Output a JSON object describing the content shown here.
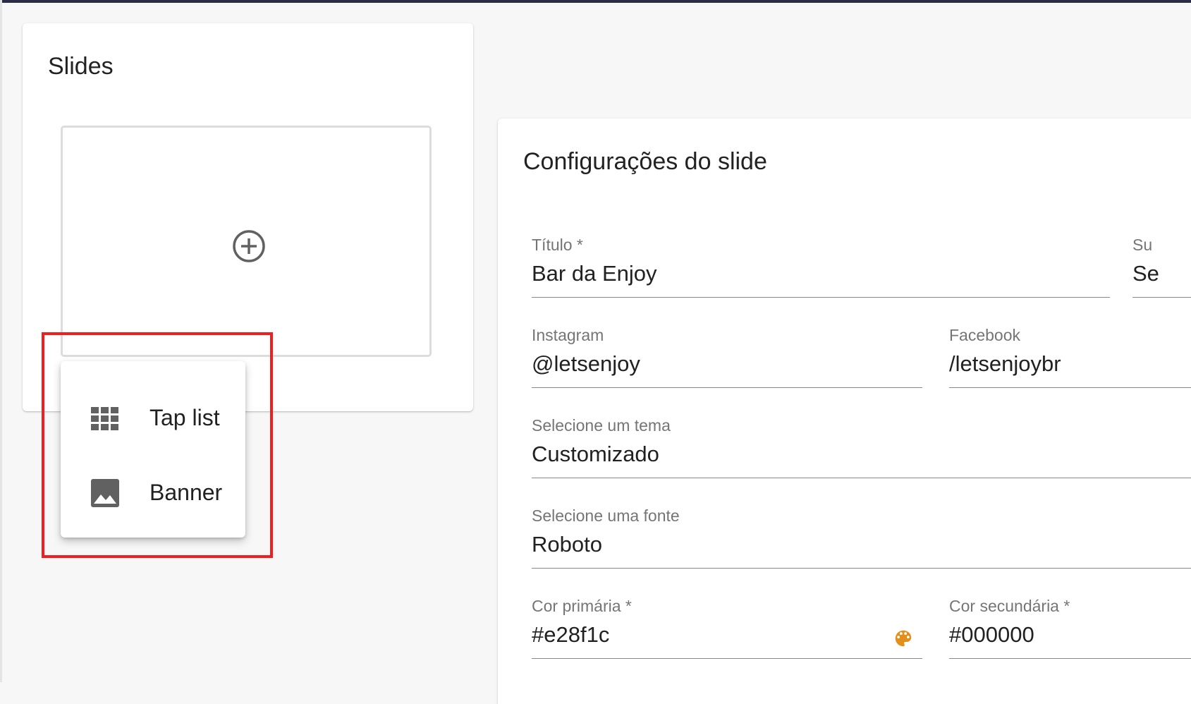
{
  "slides_panel": {
    "title": "Slides"
  },
  "add_menu": {
    "items": [
      {
        "label": "Tap list",
        "icon": "grid-icon"
      },
      {
        "label": "Banner",
        "icon": "image-icon"
      }
    ]
  },
  "config_panel": {
    "title": "Configurações do slide",
    "fields": {
      "titulo": {
        "label": "Título *",
        "value": "Bar da Enjoy"
      },
      "subtitulo": {
        "label": "Su",
        "value": "Se"
      },
      "instagram": {
        "label": "Instagram",
        "value": "@letsenjoy"
      },
      "facebook": {
        "label": "Facebook",
        "value": "/letsenjoybr"
      },
      "tema": {
        "label": "Selecione um tema",
        "value": "Customizado"
      },
      "fonte": {
        "label": "Selecione uma fonte",
        "value": "Roboto"
      },
      "cor_primaria": {
        "label": "Cor primária *",
        "value": "#e28f1c"
      },
      "cor_secundaria": {
        "label": "Cor secundária *",
        "value": "#000000"
      }
    }
  },
  "colors": {
    "highlight": "#f01e1e",
    "palette_icon": "#e28f1c",
    "topbar": "#2c2c48"
  }
}
